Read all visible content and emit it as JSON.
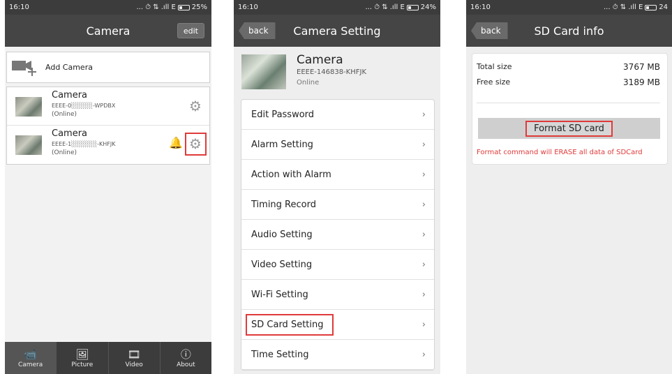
{
  "screen1": {
    "status": {
      "time": "16:10",
      "icons": "... ⏱ ⇅ .ıll E",
      "battery": "25%"
    },
    "title": "Camera",
    "edit_label": "edit",
    "add_camera_label": "Add Camera",
    "cameras": [
      {
        "name": "Camera",
        "id": "EEEE-0░░░░░-WPDBX",
        "status": "(Online)"
      },
      {
        "name": "Camera",
        "id": "EEEE-1░░░░░░-KHFJK",
        "status": "(Online)"
      }
    ],
    "tabs": [
      {
        "label": "Camera",
        "icon": "camera-icon"
      },
      {
        "label": "Picture",
        "icon": "picture-icon"
      },
      {
        "label": "Video",
        "icon": "video-icon"
      },
      {
        "label": "About",
        "icon": "info-icon"
      }
    ]
  },
  "screen2": {
    "status": {
      "time": "16:10",
      "icons": "... ⏱ ⇅ .ıll E",
      "battery": "24%"
    },
    "back_label": "back",
    "title": "Camera Setting",
    "camera": {
      "name": "Camera",
      "id": "EEEE-146838-KHFJK",
      "status": "Online"
    },
    "menu": [
      "Edit Password",
      "Alarm Setting",
      "Action with Alarm",
      "Timing Record",
      "Audio Setting",
      "Video Setting",
      "Wi-Fi Setting",
      "SD Card Setting",
      "Time Setting"
    ]
  },
  "screen3": {
    "status": {
      "time": "16:10",
      "icons": "... ⏱ ⇅ .ıll E",
      "battery": "24"
    },
    "back_label": "back",
    "title": "SD Card info",
    "total_label": "Total size",
    "total_value": "3767 MB",
    "free_label": "Free size",
    "free_value": "3189 MB",
    "format_label": "Format SD card",
    "warning": "Format command will ERASE all data of SDCard"
  },
  "colors": {
    "header": "#454545",
    "status_bar": "#3c3c3c",
    "highlight": "#e03a3a"
  }
}
